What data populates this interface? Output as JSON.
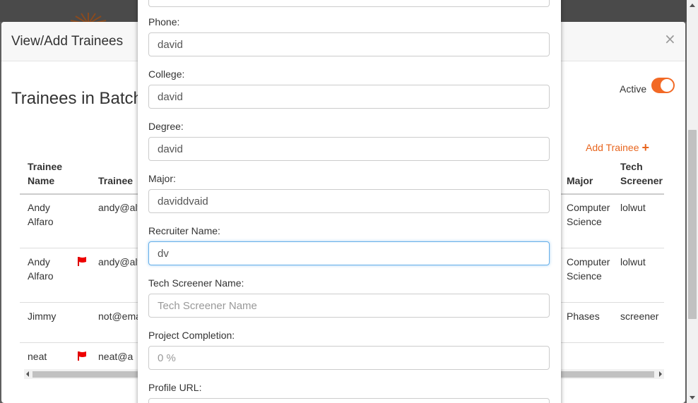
{
  "underlying": {
    "modal_title": "View/Add Trainees",
    "close_glyph": "×",
    "batch_heading": "Trainees in Batch",
    "active_label": "Active",
    "active_toggle_on": true,
    "add_trainee_label": "Add Trainee",
    "add_trainee_icon": "plus-icon",
    "accent_color": "#f26925",
    "columns": {
      "trainee_name_1": "Trainee",
      "trainee_name_2": "Name",
      "trainee_email": "Trainee",
      "major": "Major",
      "tech_screener_1": "Tech",
      "tech_screener_2": "Screener"
    },
    "rows": [
      {
        "name_1": "Andy",
        "name_2": "Alfaro",
        "flagged": false,
        "email": "andy@alf",
        "major_1": "Computer",
        "major_2": "Science",
        "screener": "lolwut"
      },
      {
        "name_1": "Andy",
        "name_2": "Alfaro",
        "flagged": true,
        "email": "andy@alf",
        "major_1": "Computer",
        "major_2": "Science",
        "screener": "lolwut"
      },
      {
        "name_1": "Jimmy",
        "name_2": "",
        "flagged": false,
        "email": "not@ema",
        "major_1": "Phases",
        "major_2": "",
        "screener": "screener"
      },
      {
        "name_1": "neat",
        "name_2": "",
        "flagged": true,
        "email": "neat@a",
        "major_1": "",
        "major_2": "",
        "screener": ""
      }
    ]
  },
  "form": {
    "fields": [
      {
        "label": "Phone:",
        "value": "david",
        "placeholder": ""
      },
      {
        "label": "College:",
        "value": "david",
        "placeholder": ""
      },
      {
        "label": "Degree:",
        "value": "david",
        "placeholder": ""
      },
      {
        "label": "Major:",
        "value": "daviddvaid",
        "placeholder": ""
      },
      {
        "label": "Recruiter Name:",
        "value": "dv",
        "placeholder": ""
      },
      {
        "label": "Tech Screener Name:",
        "value": "",
        "placeholder": "Tech Screener Name"
      },
      {
        "label": "Project Completion:",
        "value": "",
        "placeholder": "0 %"
      },
      {
        "label": "Profile URL:",
        "value": "",
        "placeholder": ""
      }
    ]
  }
}
